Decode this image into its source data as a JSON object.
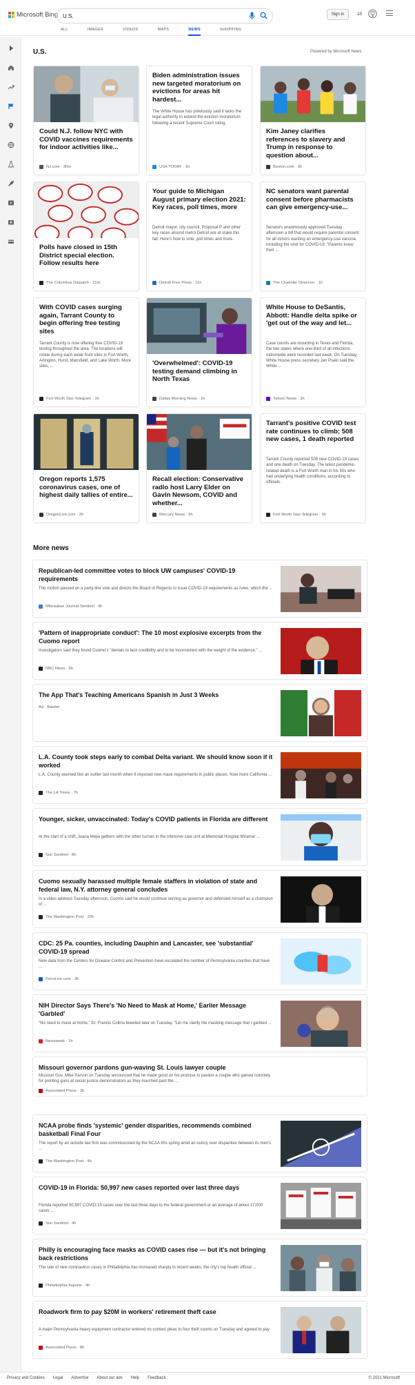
{
  "header": {
    "logo_text": "Microsoft Bing",
    "search_value": "U.S.",
    "sign_in": "Sign in",
    "points": "10",
    "tabs": [
      "ALL",
      "IMAGES",
      "VIDEOS",
      "MAPS",
      "NEWS",
      "SHOPPING"
    ],
    "active_tab": "NEWS",
    "accent": "#174ae4"
  },
  "section": {
    "title": "U.S.",
    "powered_by": "Powered by Microsoft News"
  },
  "cards": [
    {
      "title": "Could N.J. follow NYC with COVID vaccines requirements for indoor activities like...",
      "source": "NJ.com",
      "time": "30m",
      "image": "vaccine-photo",
      "src_color": "#555"
    },
    {
      "title": "Biden administration issues new targeted moratorium on evictions for areas hit hardest...",
      "summary": "The White House has previously said it lacks the legal authority to extend the eviction moratorium following a recent Supreme Court ruling.",
      "source": "USA TODAY",
      "time": "1h",
      "src_color": "#1a8ae5"
    },
    {
      "title": "Kim Janey clarifies references to slavery and Trump in response to question about...",
      "source": "Boston.com",
      "time": "3h",
      "image": "crowd-photo",
      "src_color": "#333"
    },
    {
      "title": "Polls have closed in 15th District special election. Follow results here",
      "source": "The Columbus Dispatch",
      "time": "31m",
      "image": "stickers-photo",
      "src_color": "#222"
    },
    {
      "title": "Your guide to Michigan August primary election 2021: Key races, poll times, more",
      "summary": "Detroit mayor, city council, Proposal P and other key races around metro Detroit are at stake this fall. Here's how to vote, poll times and more.",
      "source": "Detroit Free Press",
      "time": "11h",
      "src_color": "#2a6ab8"
    },
    {
      "title": "NC senators want parental consent before pharmacists can give emergency-use...",
      "summary": "Senators unanimously approved Tuesday afternoon a bill that would require parental consent for all minors wanting an emergency-use vaccine, including the shot for COVID-19. \"Parents know their ...",
      "source": "The Charlotte Observer",
      "time": "1h",
      "src_color": "#1f7d9c"
    },
    {
      "title": "With COVID cases surging again, Tarrant County to begin offering free testing sites",
      "summary": "Tarrant County is now offering free COVID-19 testing throughout the area. The locations will rotate during each week from sites in Fort Worth, Arlington, Hurst, Mansfield, and Lake Worth. More sites, ...",
      "source": "Fort Worth Star-Telegram",
      "time": "1h",
      "src_color": "#222"
    },
    {
      "title": "'Overwhelmed': COVID-19 testing demand climbing in North Texas",
      "source": "Dallas Morning News",
      "time": "1h",
      "image": "testing-photo",
      "src_color": "#444"
    },
    {
      "title": "White House to DeSantis, Abbott: Handle delta spike or 'get out of the way and let...",
      "summary": "Case counts are mounting in Texas and Florida, the two states where one-third of all infections nationwide were recorded last week. On Tuesday, White House press secretary Jen Psaki said the White ...",
      "source": "Yahoo! News",
      "time": "3h",
      "src_color": "#6001d2"
    },
    {
      "title": "Oregon reports 1,575 coronavirus cases, one of highest daily tallies of entire...",
      "source": "OregonLive.com",
      "time": "2h",
      "image": "lab-photo",
      "src_color": "#333"
    },
    {
      "title": "Recall election: Conservative radio host Larry Elder on Gavin Newsom, COVID and whether...",
      "source": "Mercury News",
      "time": "5h",
      "image": "rally-photo",
      "src_color": "#444"
    },
    {
      "title": "Tarrant's positive COVID test rate continues to climb; 508 new cases, 1 death reported",
      "summary": "Tarrant County reported 508 new COVID-19 cases and one death on Tuesday. The latest pandemic-related death is a Fort Worth man in his 50s who had underlying health conditions, according to officials.",
      "source": "Fort Worth Star-Telegram",
      "time": "3h",
      "src_color": "#222"
    }
  ],
  "more_news_title": "More news",
  "more_news": [
    {
      "title": "Republican-led committee votes to block UW campuses' COVID-19 requirements",
      "summary": "The motion passed on a party-line vote and directs the Board of Regents to issue COVID-19 requirements as rules, which the ...",
      "source": "Milwaukee Journal-Sentinel",
      "time": "4h",
      "image": "desk-photo",
      "src_color": "#3a7bd5"
    },
    {
      "title": "'Pattern of inappropriate conduct': The 10 most explosive excerpts from the Cuomo report",
      "summary": "Investigators said they found Cuomo's \"denials to lack credibility and to be inconsistent with the weight of the evidence.\" ...",
      "source": "NBC News",
      "time": "6h",
      "image": "portrait-red",
      "src_color": "#222"
    },
    {
      "title": "The App That's Teaching Americans Spanish in Just 3 Weeks",
      "ad": "Ad",
      "source": "Babbel",
      "image": "mexico-flag",
      "src_color": "#fff"
    },
    {
      "title": "L.A. County took steps early to combat Delta variant. We should know soon if it worked",
      "summary": "L.A. County seemed like an outlier last month when it imposed new mask requirements in public places. Now more California ...",
      "source": "The LA Times",
      "time": "7h",
      "image": "street-night",
      "src_color": "#222"
    },
    {
      "title": "Younger, sicker, unvaccinated: Today's COVID patients in Florida are different",
      "summary": "At the start of a shift, Juana Mejia gathers with the other nurses in the intensive care unit at Memorial Hospital Miramar ...",
      "source": "Sun Sentinel",
      "time": "8h",
      "image": "nurse-photo",
      "src_color": "#222"
    },
    {
      "title": "Cuomo sexually harassed multiple female staffers in violation of state and federal law, N.Y. attorney general concludes",
      "summary": "In a video address Tuesday afternoon, Cuomo said he would continue serving as governor and defended himself as a champion of ...",
      "source": "The Washington Post",
      "time": "10h",
      "image": "portrait-dark",
      "src_color": "#222"
    },
    {
      "title": "CDC: 25 Pa. counties, including Dauphin and Lancaster, see 'substantial' COVID-19 spread",
      "summary": "New data from the Centers for Disease Control and Prevention have escalated the number of Pennsylvania counties that have ...",
      "source": "PennLive.com",
      "time": "3h",
      "image": "gloves-photo",
      "src_color": "#1e5bb8"
    },
    {
      "title": "NIH Director Says There's 'No Need to Mask at Home,' Earlier Message 'Garbled'",
      "summary": "\"No need to mask at home,\" Dr. Francis Collins tweeted later on Tuesday. \"Let me clarify the masking message that I garbled ...",
      "source": "Newsweek",
      "time": "1h",
      "image": "collins-photo",
      "src_color": "#d22"
    },
    {
      "title": "Missouri governor pardons gun-waving St. Louis lawyer couple",
      "summary": "Missouri Gov. Mike Parson on Tuesday announced that he made good on his promise to pardon a couple who gained notoriety for pointing guns at social justice demonstrators as they marched past the ...",
      "source": "Associated Press",
      "time": "3h",
      "src_color": "#c00"
    },
    {
      "title": "NCAA probe finds 'systemic' gender disparities, recommends combined basketball Final Four",
      "summary": "The report by an outside law firm was commissioned by the NCAA this spring amid an outcry over disparities between its men's ...",
      "source": "The Washington Post",
      "time": "4h",
      "image": "court-photo",
      "src_color": "#222"
    },
    {
      "title": "COVID-19 in Florida: 50,997 new cases reported over last three days",
      "summary": "Florida reported 50,997 COVID-19 cases over the last three days to the federal government or an average of about 17,000 cases ...",
      "source": "Sun Sentinel",
      "time": "4h",
      "image": "signs-photo",
      "src_color": "#222"
    },
    {
      "title": "Philly is encouraging face masks as COVID cases rise — but it's not bringing back restrictions",
      "summary": "The rate of new coronavirus cases in Philadelphia has increased sharply in recent weeks, the city's top health official ...",
      "source": "Philadelphia Inquirer",
      "time": "4h",
      "image": "masks-street",
      "src_color": "#222"
    },
    {
      "title": "Roadwork firm to pay $20M in workers' retirement theft case",
      "summary": "A major Pennsylvania heavy equipment contractor entered no contest pleas to four theft counts on Tuesday and agreed to pay ...",
      "source": "Associated Press",
      "time": "8h",
      "image": "suits-photo",
      "src_color": "#c00"
    }
  ],
  "footer": {
    "links": [
      "Privacy and Cookies",
      "Legal",
      "Advertise",
      "About our ads",
      "Help",
      "Feedback"
    ],
    "copyright": "© 2021 Microsoft"
  }
}
